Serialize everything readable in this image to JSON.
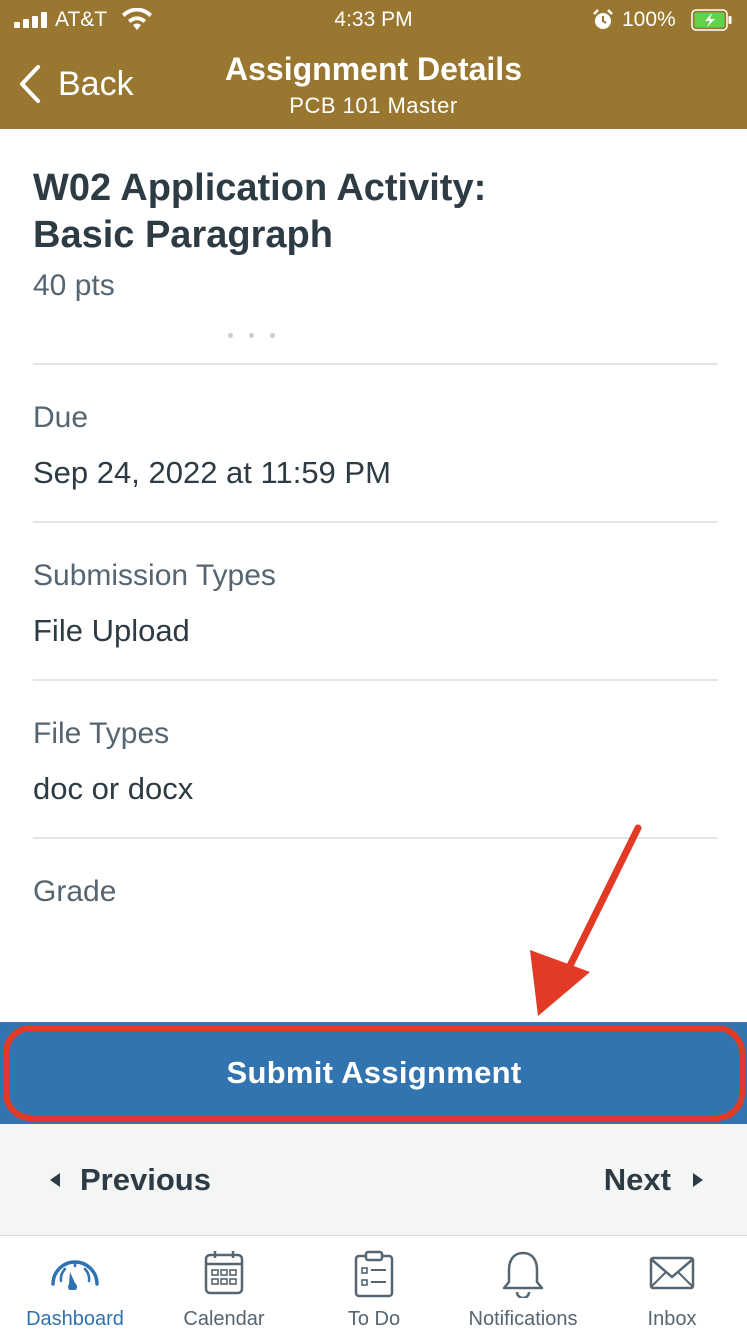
{
  "status_bar": {
    "carrier": "AT&T",
    "time": "4:33 PM",
    "battery_percent": "100%"
  },
  "header": {
    "back_label": "Back",
    "title": "Assignment Details",
    "subtitle": "PCB 101 Master"
  },
  "assignment": {
    "title_line1": "W02 Application Activity:",
    "title_line2": "Basic Paragraph",
    "points": "40 pts"
  },
  "sections": {
    "due": {
      "label": "Due",
      "value": "Sep 24, 2022 at 11:59 PM"
    },
    "submission_types": {
      "label": "Submission Types",
      "value": "File Upload"
    },
    "file_types": {
      "label": "File Types",
      "value": "doc or docx"
    },
    "grade": {
      "label": "Grade",
      "value": ""
    }
  },
  "submit_button": {
    "label": "Submit Assignment"
  },
  "pager": {
    "previous_label": "Previous",
    "next_label": "Next"
  },
  "tabs": [
    {
      "label": "Dashboard",
      "icon": "dashboard-gauge-icon",
      "active": true
    },
    {
      "label": "Calendar",
      "icon": "calendar-icon",
      "active": false
    },
    {
      "label": "To Do",
      "icon": "clipboard-icon",
      "active": false
    },
    {
      "label": "Notifications",
      "icon": "bell-icon",
      "active": false
    },
    {
      "label": "Inbox",
      "icon": "envelope-icon",
      "active": false
    }
  ],
  "colors": {
    "header_bg": "#997730",
    "submit_bg": "#3274b0",
    "annotation_red": "#e33a25",
    "active_tab": "#2f72b3",
    "text_primary": "#2d3b45",
    "text_secondary": "#556572"
  }
}
